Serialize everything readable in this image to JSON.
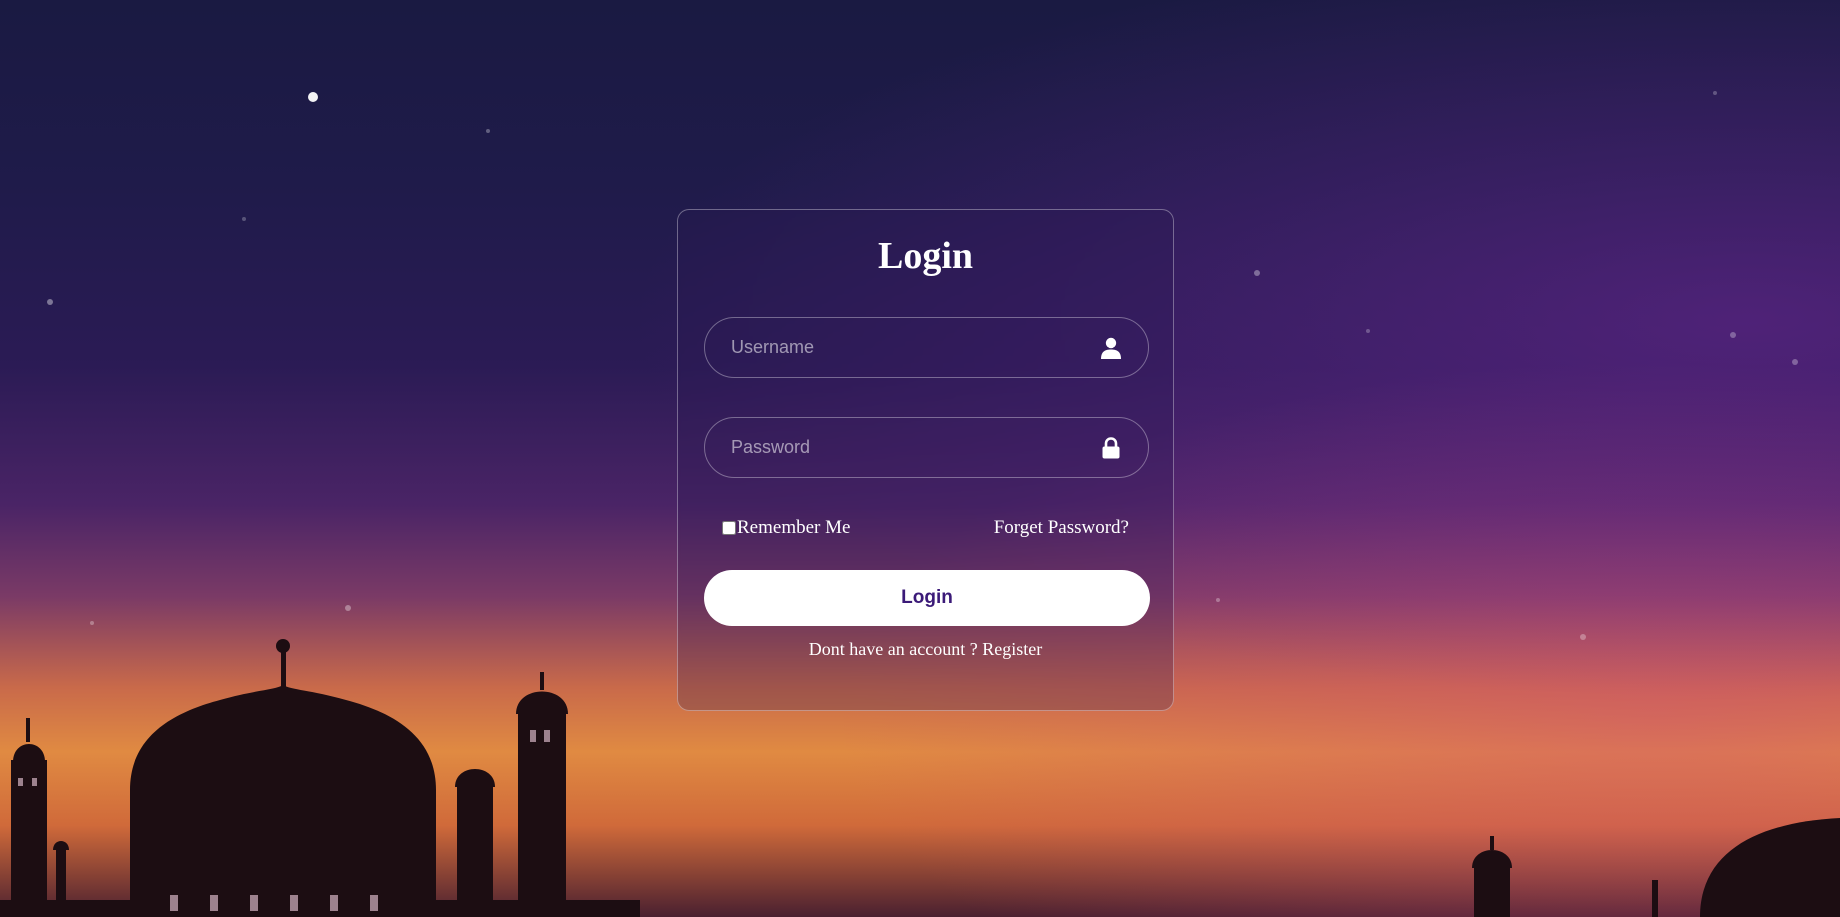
{
  "login": {
    "title": "Login",
    "username_placeholder": "Username",
    "password_placeholder": "Password",
    "remember_label": "Remember Me",
    "forgot_label": "Forget Password?",
    "button_label": "Login",
    "register_prompt": "Dont have an account ?",
    "register_link": "Register"
  },
  "icons": {
    "username": "user-icon",
    "password": "lock-icon"
  },
  "colors": {
    "button_text": "#3b1a78",
    "button_bg": "#ffffff"
  }
}
